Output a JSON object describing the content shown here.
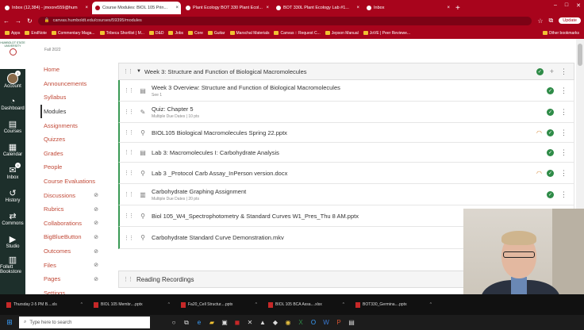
{
  "browser": {
    "tabs": [
      {
        "label": "Inbox (12,384) - jmoore559@hum",
        "active": false
      },
      {
        "label": "Course Modules: BIOL 105 Prin...",
        "active": true
      },
      {
        "label": "Plant Ecology BOT 330 Plant Ecol...",
        "active": false
      },
      {
        "label": "BOT 330L Plant Ecology Lab #1...",
        "active": false
      },
      {
        "label": "Inbox",
        "active": false
      }
    ],
    "url": "canvas.humboldt.edu/courses/59395/modules",
    "update_label": "Update",
    "bookmarks": [
      "Apps",
      "EndNote",
      "Commentary Maga...",
      "Tribeca Shortlist | M...",
      "D&D",
      "Jobs",
      "Core",
      "Guitar",
      "Marschal Materials",
      "Canvas :: Request C...",
      "Jepson Manual",
      "JoVE | Peer Reviewe..."
    ],
    "other_bookmarks": "Other bookmarks"
  },
  "global_nav": {
    "logo_text": "HUMBOLDT STATE UNIVERSITY",
    "items": [
      {
        "label": "Account",
        "icon": "avatar-icon"
      },
      {
        "label": "Dashboard",
        "icon": "dashboard-icon"
      },
      {
        "label": "Courses",
        "icon": "book-icon"
      },
      {
        "label": "Calendar",
        "icon": "calendar-icon"
      },
      {
        "label": "Inbox",
        "icon": "inbox-icon",
        "badge": "9"
      },
      {
        "label": "History",
        "icon": "clock-icon"
      },
      {
        "label": "Commons",
        "icon": "commons-icon"
      },
      {
        "label": "Studio",
        "icon": "studio-icon"
      },
      {
        "label": "Follett Bookstore",
        "icon": "bookstore-icon"
      }
    ],
    "account_badge": "1"
  },
  "course_nav": {
    "term": "Fall 2022",
    "links": [
      {
        "label": "Home",
        "hidden": false
      },
      {
        "label": "Announcements",
        "hidden": false
      },
      {
        "label": "Syllabus",
        "hidden": false
      },
      {
        "label": "Modules",
        "hidden": false,
        "current": true
      },
      {
        "label": "Assignments",
        "hidden": false
      },
      {
        "label": "Quizzes",
        "hidden": false
      },
      {
        "label": "Grades",
        "hidden": false
      },
      {
        "label": "People",
        "hidden": false
      },
      {
        "label": "Course Evaluations",
        "hidden": false
      },
      {
        "label": "Discussions",
        "hidden": true
      },
      {
        "label": "Rubrics",
        "hidden": true
      },
      {
        "label": "Collaborations",
        "hidden": true
      },
      {
        "label": "BigBlueButton",
        "hidden": true
      },
      {
        "label": "Outcomes",
        "hidden": true
      },
      {
        "label": "Files",
        "hidden": true
      },
      {
        "label": "Pages",
        "hidden": true
      },
      {
        "label": "Settings",
        "hidden": false
      }
    ]
  },
  "module": {
    "title": "Week 3: Structure and Function of Biological Macromolecules",
    "items": [
      {
        "title": "Week 3 Overview: Structure and Function of Biological Macromolecules",
        "sub": "See 1",
        "type": "page-icon",
        "gauge": false
      },
      {
        "title": "Quiz: Chapter 5",
        "sub": "Multiple Due Dates  |  10 pts",
        "type": "quiz-icon",
        "gauge": false
      },
      {
        "title": "BIOL105 Biological Macromolecules Spring 22.pptx",
        "sub": "",
        "type": "attachment-icon",
        "gauge": true
      },
      {
        "title": "Lab 3: Macromolecules I: Carbohydrate Analysis",
        "sub": "",
        "type": "page-icon",
        "gauge": false
      },
      {
        "title": "Lab 3 _Protocol Carb Assay_InPerson version.docx",
        "sub": "",
        "type": "attachment-icon",
        "gauge": true
      },
      {
        "title": "Carbohydrate Graphing Assignment",
        "sub": "Multiple Due Dates  |  20 pts",
        "type": "assignment-icon",
        "gauge": false
      },
      {
        "title": "Biol 105_W4_Spectrophotometry & Standard Curves W1_Pres_Thu 8 AM.pptx",
        "sub": "",
        "type": "attachment-icon",
        "gauge": false
      },
      {
        "title": "Carbohydrate Standard Curve Demonstration.mkv",
        "sub": "",
        "type": "attachment-icon",
        "gauge": false
      }
    ],
    "next_module": "Reading Recordings"
  },
  "taskbar": {
    "downloads": [
      "Thursday 2-5 PM B....xls",
      "BIOL 105 Membr....pptx",
      "Fa20_Cell Structur....pptx",
      "BIOL 105 BCA Assa....xlsx",
      "BOT330_Germina....pptx"
    ],
    "search_placeholder": "Type here to search"
  },
  "colors": {
    "brand": "#a8041c",
    "nav": "#1d2f2b",
    "link": "#c14a38",
    "published": "#2e8b47"
  }
}
